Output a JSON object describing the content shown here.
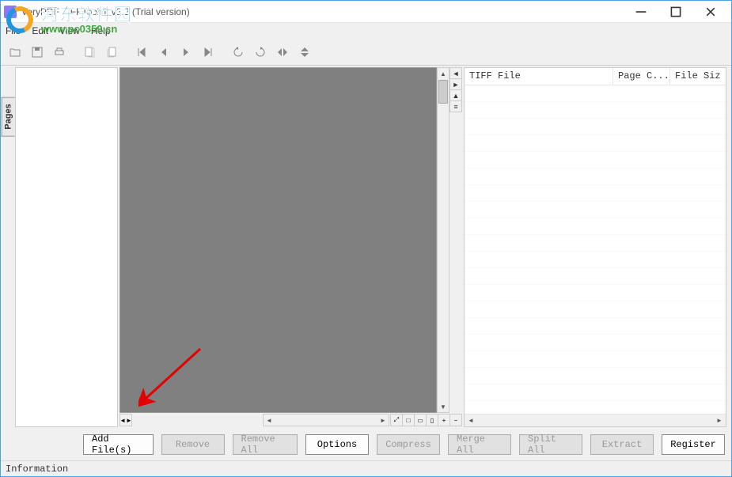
{
  "window": {
    "title": "VeryPDF TIFFToolkit v2.2 (Trial version)"
  },
  "menu": {
    "file": "File",
    "edit": "Edit",
    "view": "View",
    "help": "Help"
  },
  "watermark": {
    "cn": "河东软件园",
    "url": "www.pc0359.cn"
  },
  "pages_tab": "Pages",
  "file_list": {
    "col1": "TIFF File",
    "col2": "Page C...",
    "col3": "File Siz"
  },
  "actions": {
    "add_files": "Add File(s)",
    "remove": "Remove",
    "remove_all": "Remove All",
    "options": "Options",
    "compress": "Compress",
    "merge_all": "Merge All",
    "split_all": "Split All",
    "extract": "Extract",
    "register": "Register"
  },
  "status": {
    "label": "Information"
  },
  "toolbar_icons": {
    "open": "open-icon",
    "save": "save-icon",
    "print": "print-icon",
    "page_prev": "page-prev-icon",
    "page_next": "page-next-icon",
    "first": "first-page-icon",
    "last": "last-page-icon",
    "rotate_left": "rotate-left-icon",
    "rotate_right": "rotate-right-icon",
    "flip_h": "flip-horizontal-icon",
    "flip_v": "flip-vertical-icon"
  }
}
